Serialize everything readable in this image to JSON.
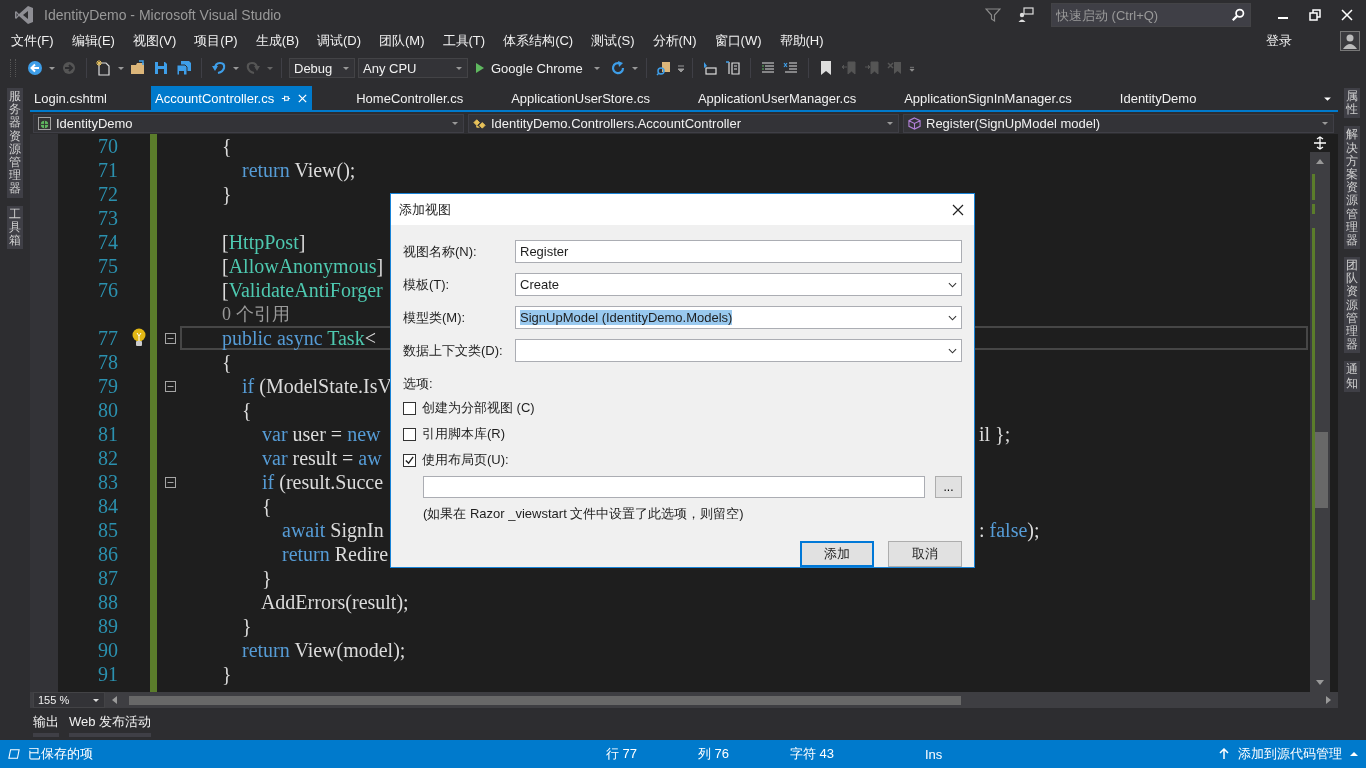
{
  "window": {
    "title": "IdentityDemo - Microsoft Visual Studio",
    "quick_launch": {
      "placeholder": "快速启动 (Ctrl+Q)"
    }
  },
  "menu": {
    "items": [
      "文件(F)",
      "编辑(E)",
      "视图(V)",
      "项目(P)",
      "生成(B)",
      "调试(D)",
      "团队(M)",
      "工具(T)",
      "体系结构(C)",
      "测试(S)",
      "分析(N)",
      "窗口(W)",
      "帮助(H)"
    ],
    "sign_in": "登录"
  },
  "toolbar": {
    "configuration": "Debug",
    "platform": "Any CPU",
    "run_target": "Google Chrome"
  },
  "left_panels": [
    "服务器资源管理器",
    "工具箱"
  ],
  "right_panels": [
    "属性",
    "解决方案资源管理器",
    "团队资源管理器",
    "通知"
  ],
  "tabs": [
    {
      "label": "Login.cshtml",
      "selected": false
    },
    {
      "label": "AccountController.cs",
      "selected": true
    },
    {
      "label": "HomeController.cs",
      "selected": false
    },
    {
      "label": "ApplicationUserStore.cs",
      "selected": false
    },
    {
      "label": "ApplicationUserManager.cs",
      "selected": false
    },
    {
      "label": "ApplicationSignInManager.cs",
      "selected": false
    },
    {
      "label": "IdentityDemo",
      "selected": false
    }
  ],
  "navigation": {
    "project": "IdentityDemo",
    "type": "IdentityDemo.Controllers.AccountController",
    "member": "Register(SignUpModel model)"
  },
  "code_lines": [
    {
      "kind": "code",
      "number": "70",
      "current": false,
      "foldable": false,
      "lightbulb": false,
      "parts": [
        {
          "text": "{",
          "kind": "plain"
        }
      ]
    },
    {
      "kind": "code",
      "number": "71",
      "current": false,
      "foldable": false,
      "lightbulb": false,
      "parts": [
        {
          "text": "    return",
          "kind": "keyword"
        },
        {
          "text": " View();",
          "kind": "plain"
        }
      ]
    },
    {
      "kind": "code",
      "number": "72",
      "current": false,
      "foldable": false,
      "lightbulb": false,
      "parts": [
        {
          "text": "}",
          "kind": "plain"
        }
      ]
    },
    {
      "kind": "code",
      "number": "73",
      "current": false,
      "foldable": false,
      "lightbulb": false
    },
    {
      "kind": "code",
      "number": "74",
      "current": false,
      "foldable": false,
      "lightbulb": false,
      "parts": [
        {
          "text": "[",
          "kind": "plain"
        },
        {
          "text": "HttpPost",
          "kind": "type"
        },
        {
          "text": "]",
          "kind": "plain"
        }
      ]
    },
    {
      "kind": "code",
      "number": "75",
      "current": false,
      "foldable": false,
      "lightbulb": false,
      "parts": [
        {
          "text": "[",
          "kind": "plain"
        },
        {
          "text": "AllowAnonymous",
          "kind": "type"
        },
        {
          "text": "]",
          "kind": "plain"
        }
      ]
    },
    {
      "kind": "code",
      "number": "76",
      "current": false,
      "foldable": false,
      "lightbulb": false,
      "parts": [
        {
          "text": "[",
          "kind": "plain"
        },
        {
          "text": "ValidateAntiForger",
          "kind": "type"
        }
      ]
    },
    {
      "kind": "codelens",
      "text": "0 个引用"
    },
    {
      "kind": "code",
      "number": "77",
      "current": true,
      "foldable": true,
      "lightbulb": true,
      "parts": [
        {
          "text": "public async",
          "kind": "keyword"
        },
        {
          "text": " Task",
          "kind": "type"
        },
        {
          "text": "<",
          "kind": "plain"
        }
      ]
    },
    {
      "kind": "code",
      "number": "78",
      "current": false,
      "foldable": false,
      "lightbulb": false,
      "parts": [
        {
          "text": "{",
          "kind": "plain"
        }
      ]
    },
    {
      "kind": "code",
      "number": "79",
      "current": false,
      "foldable": true,
      "lightbulb": false,
      "parts": [
        {
          "text": "    if",
          "kind": "keyword"
        },
        {
          "text": " (ModelState.IsV",
          "kind": "plain"
        }
      ]
    },
    {
      "kind": "code",
      "number": "80",
      "current": false,
      "foldable": false,
      "lightbulb": false,
      "parts": [
        {
          "text": "    {",
          "kind": "plain"
        }
      ]
    },
    {
      "kind": "code",
      "number": "81",
      "current": false,
      "foldable": false,
      "lightbulb": false,
      "parts": [
        {
          "text": "        var",
          "kind": "keyword"
        },
        {
          "text": " user = ",
          "kind": "plain"
        },
        {
          "text": "new",
          "kind": "keyword"
        }
      ],
      "tail": [
        {
          "text": "il };",
          "kind": "plain"
        }
      ]
    },
    {
      "kind": "code",
      "number": "82",
      "current": false,
      "foldable": false,
      "lightbulb": false,
      "parts": [
        {
          "text": "        var",
          "kind": "keyword"
        },
        {
          "text": " result = ",
          "kind": "plain"
        },
        {
          "text": "aw",
          "kind": "keyword"
        }
      ]
    },
    {
      "kind": "code",
      "number": "83",
      "current": false,
      "foldable": true,
      "lightbulb": false,
      "parts": [
        {
          "text": "        if",
          "kind": "keyword"
        },
        {
          "text": " (result.Succe",
          "kind": "plain"
        }
      ]
    },
    {
      "kind": "code",
      "number": "84",
      "current": false,
      "foldable": false,
      "lightbulb": false,
      "parts": [
        {
          "text": "        {",
          "kind": "plain"
        }
      ]
    },
    {
      "kind": "code",
      "number": "85",
      "current": false,
      "foldable": false,
      "lightbulb": false,
      "parts": [
        {
          "text": "            await",
          "kind": "keyword"
        },
        {
          "text": " SignIn",
          "kind": "plain"
        }
      ],
      "tail": [
        {
          "text": ": ",
          "kind": "plain"
        },
        {
          "text": "false",
          "kind": "keyword"
        },
        {
          "text": ");",
          "kind": "plain"
        }
      ]
    },
    {
      "kind": "code",
      "number": "86",
      "current": false,
      "foldable": false,
      "lightbulb": false,
      "parts": [
        {
          "text": "            return",
          "kind": "keyword"
        },
        {
          "text": " Redire",
          "kind": "plain"
        }
      ]
    },
    {
      "kind": "code",
      "number": "87",
      "current": false,
      "foldable": false,
      "lightbulb": false,
      "parts": [
        {
          "text": "        }",
          "kind": "plain"
        }
      ]
    },
    {
      "kind": "code",
      "number": "88",
      "current": false,
      "foldable": false,
      "lightbulb": false,
      "parts": [
        {
          "text": "        AddErrors(result);",
          "kind": "plain"
        }
      ]
    },
    {
      "kind": "code",
      "number": "89",
      "current": false,
      "foldable": false,
      "lightbulb": false,
      "parts": [
        {
          "text": "    }",
          "kind": "plain"
        }
      ]
    },
    {
      "kind": "code",
      "number": "90",
      "current": false,
      "foldable": false,
      "lightbulb": false,
      "parts": [
        {
          "text": "    return",
          "kind": "keyword"
        },
        {
          "text": " View(model);",
          "kind": "plain"
        }
      ]
    },
    {
      "kind": "code",
      "number": "91",
      "current": false,
      "foldable": false,
      "lightbulb": false,
      "parts": [
        {
          "text": "}",
          "kind": "plain"
        }
      ]
    }
  ],
  "zoom": "155 %",
  "dialog": {
    "title": "添加视图",
    "fields": [
      {
        "label": "视图名称(N):",
        "kind": "text",
        "value": "Register",
        "highlighted": false
      },
      {
        "label": "模板(T):",
        "kind": "dropdown",
        "value": "Create",
        "highlighted": false
      },
      {
        "label": "模型类(M):",
        "kind": "dropdown",
        "value": "SignUpModel (IdentityDemo.Models)",
        "highlighted": true
      },
      {
        "label": "数据上下文类(D):",
        "kind": "dropdown"
      }
    ],
    "options_label": "选项:",
    "options": [
      {
        "label": "创建为分部视图 (C)",
        "checked": false
      },
      {
        "label": "引用脚本库(R)",
        "checked": false
      },
      {
        "label": "使用布局页(U):",
        "checked": true
      }
    ],
    "browse_button": "...",
    "hint": "(如果在 Razor _viewstart 文件中设置了此选项，则留空)",
    "buttons": [
      {
        "label": "添加",
        "default": true
      },
      {
        "label": "取消",
        "default": false
      }
    ]
  },
  "bottom_tabs": [
    "输出",
    "Web 发布活动"
  ],
  "status_bar": {
    "message": "已保存的项",
    "line": "行 77",
    "column": "列 76",
    "character": "字符 43",
    "mode": "Ins",
    "source_control": "添加到源代码管理"
  }
}
